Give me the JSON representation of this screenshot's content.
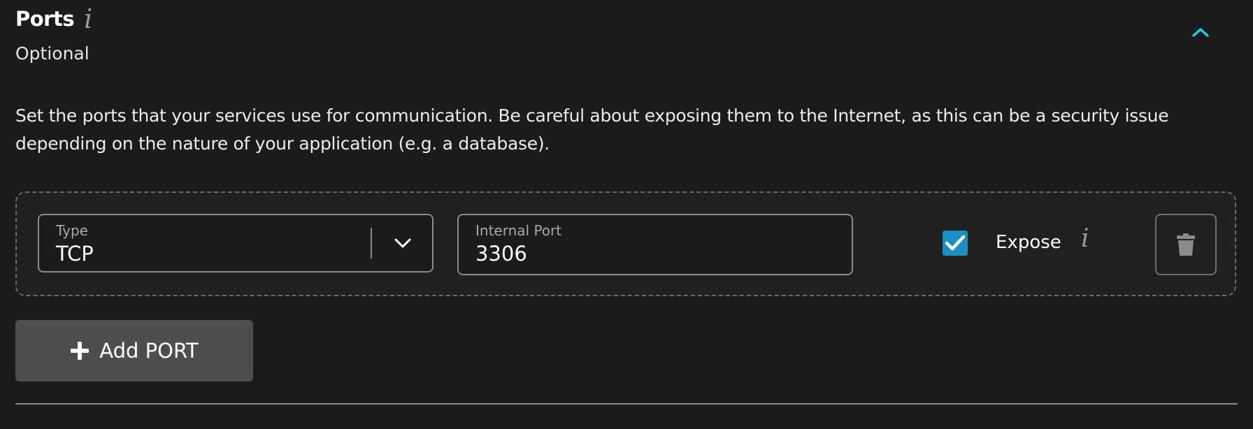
{
  "section": {
    "title": "Ports",
    "info_icon": "info-icon",
    "subtitle": "Optional",
    "toggle_icon": "chevron-up-icon",
    "accent_color": "#19d3e8",
    "description": "Set the ports that your services use for communication. Be careful about exposing them to the Internet, as this can be a security issue depending on the nature of your application (e.g. a database)."
  },
  "port_rows": [
    {
      "type": {
        "label": "Type",
        "value": "TCP",
        "icon": "chevron-down-icon"
      },
      "internal_port": {
        "label": "Internal Port",
        "value": "3306"
      },
      "expose": {
        "checked": true,
        "label": "Expose",
        "info_icon": "info-icon",
        "checkbox_color": "#1b8fc4"
      },
      "delete_icon": "trash-icon"
    }
  ],
  "add_button": {
    "icon": "plus-icon",
    "label": "Add PORT"
  },
  "info_glyph": "i"
}
